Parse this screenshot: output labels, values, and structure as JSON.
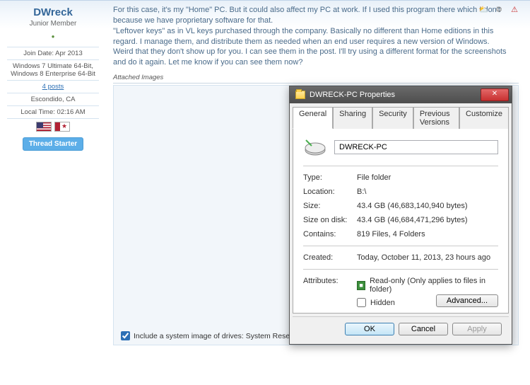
{
  "user": {
    "name": "DWreck",
    "role": "Junior Member",
    "join_label": "Join Date:",
    "join_value": "Apr 2013",
    "os_line": "Windows 7 Ultimate 64-Bit, Windows 8 Enterprise 64-Bit",
    "posts_link": "4 posts",
    "location": "Escondido, CA",
    "localtime_label": "Local Time:",
    "localtime_value": "02:16 AM",
    "thread_starter": "Thread Starter"
  },
  "post": {
    "p1": "For this case, it's my \"Home\" PC. But it could also affect my PC at work. If I used this program there which I don't because we have proprietary software for that.",
    "p2": "\"Leftover keys\" as in VL keys purchased through the company. Basically no different than Home editions in this regard. I manage them, and distribute them as needed when an end user requires a new version of Windows.",
    "p3": "Weird that they don't show up for you. I can see them in the post. I'll try using a different format for the screenshots and do it again. Let me know if you can see them now?",
    "attached_label": "Attached Images",
    "include_label": "Include a system image of drives: System Reserved, (C:)"
  },
  "dialog": {
    "title": "DWRECK-PC Properties",
    "tabs": {
      "general": "General",
      "sharing": "Sharing",
      "security": "Security",
      "previous": "Previous Versions",
      "customize": "Customize"
    },
    "drive_name": "DWRECK-PC",
    "rows": {
      "type_l": "Type:",
      "type_v": "File folder",
      "location_l": "Location:",
      "location_v": "B:\\",
      "size_l": "Size:",
      "size_v": "43.4 GB (46,683,140,940 bytes)",
      "sizeondisk_l": "Size on disk:",
      "sizeondisk_v": "43.4 GB (46,684,471,296 bytes)",
      "contains_l": "Contains:",
      "contains_v": "819 Files, 4 Folders",
      "created_l": "Created:",
      "created_v": "Today, October 11, 2013, 23 hours ago",
      "attributes_l": "Attributes:"
    },
    "attr_readonly": "Read-only (Only applies to files in folder)",
    "attr_hidden": "Hidden",
    "advanced": "Advanced...",
    "ok": "OK",
    "cancel": "Cancel",
    "apply": "Apply"
  }
}
